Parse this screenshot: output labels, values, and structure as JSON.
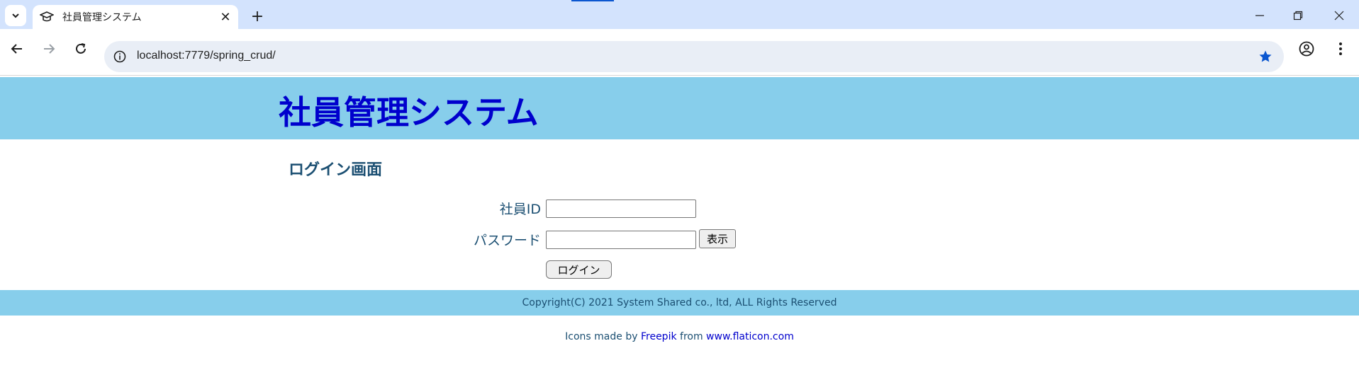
{
  "browser": {
    "tab_title": "社員管理システム",
    "url": "localhost:7779/spring_crud/",
    "colors": {
      "tabbar": "#d3e3fd",
      "star": "#0b57d0"
    }
  },
  "header": {
    "title": "社員管理システム",
    "colors": {
      "background": "#87ceeb",
      "title": "#0000cd"
    }
  },
  "login": {
    "heading": "ログイン画面",
    "employee_id_label": "社員ID",
    "employee_id_value": "",
    "password_label": "パスワード",
    "password_value": "",
    "show_button": "表示",
    "login_button": "ログイン"
  },
  "footer": {
    "copyright": "Copyright(C) 2021 System Shared co., ltd, ALL Rights Reserved"
  },
  "credits": {
    "prefix": "Icons made by ",
    "author": "Freepik",
    "middle": " from ",
    "site": "www.flaticon.com"
  }
}
